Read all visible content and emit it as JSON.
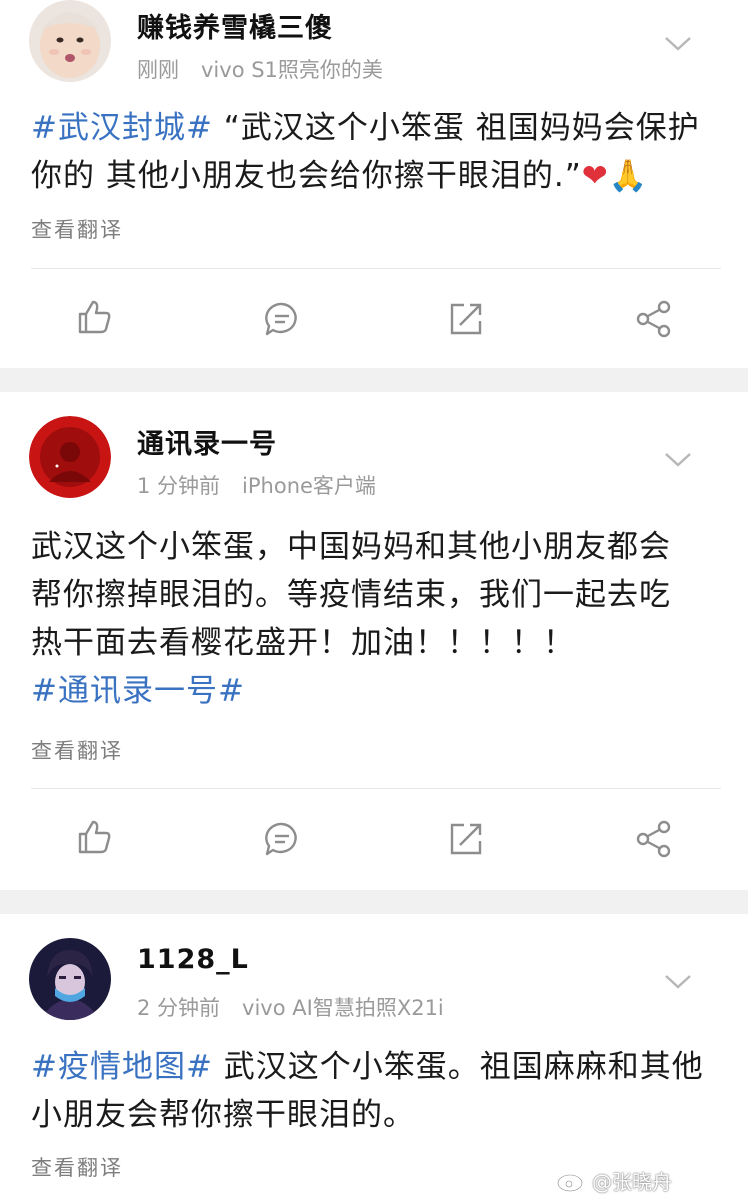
{
  "posts": [
    {
      "username": "赚钱养雪橇三傻",
      "time": "刚刚",
      "device": "vivo S1照亮你的美",
      "hashtag": "#武汉封城#",
      "text_line1_rest": " “武汉这个小笨蛋 祖国妈妈会保护",
      "text_line2": "你的 其他小朋友也会给你擦干眼泪的.”",
      "emoji": "❤🙏",
      "translate": "查看翻译"
    },
    {
      "username": "通讯录一号",
      "time": "1 分钟前",
      "device": "iPhone客户端",
      "text_line1": "武汉这个小笨蛋，中国妈妈和其他小朋友都会",
      "text_line2": "帮你擦掉眼泪的。等疫情结束，我们一起去吃",
      "text_line3": "热干面去看樱花盛开！加油！！！！！",
      "hashtag": "#通讯录一号#",
      "translate": "查看翻译"
    },
    {
      "username": "1128_L",
      "time": "2 分钟前",
      "device": "vivo AI智慧拍照X21i",
      "hashtag": "#疫情地图#",
      "text_line1_rest": " 武汉这个小笨蛋。祖国麻麻和其他",
      "text_line2": "小朋友会帮你擦干眼泪的。",
      "translate": "查看翻译"
    }
  ],
  "actions": {
    "like_icon": "thumbs-up-icon",
    "comment_icon": "comment-icon",
    "repost_icon": "repost-icon",
    "share_icon": "share-icon"
  },
  "watermark": {
    "text": "@张晓舟"
  },
  "colors": {
    "hashtag": "#3a72c2",
    "separator": "#f1f1f1",
    "meta": "#9a9a9a"
  }
}
